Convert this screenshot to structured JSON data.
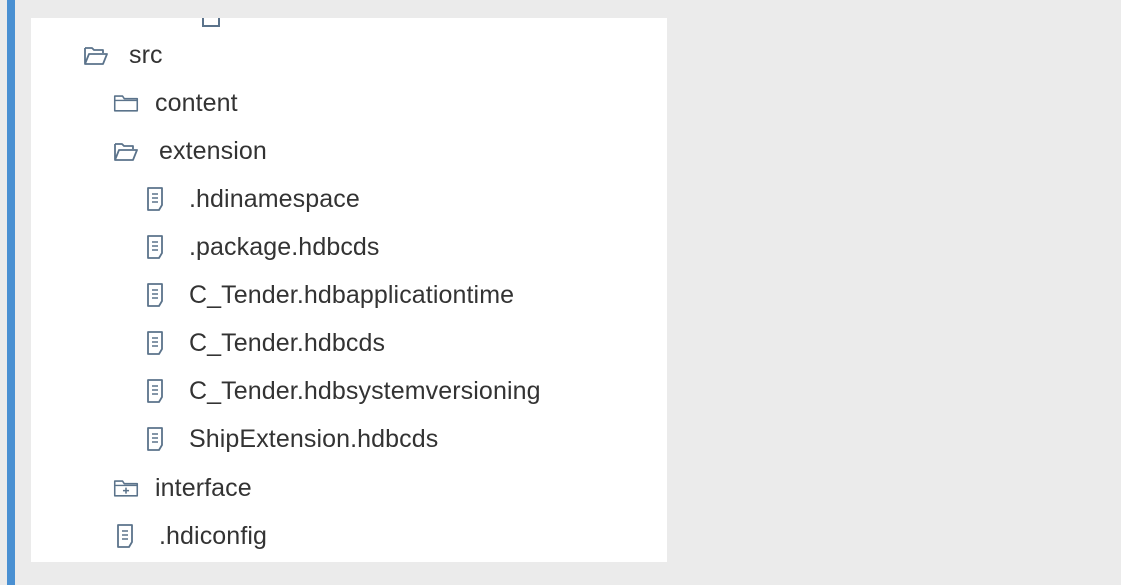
{
  "colors": {
    "accent": "#4a90d2",
    "page_bg": "#ebebeb",
    "panel_bg": "#ffffff",
    "icon_stroke": "#5b738b",
    "text": "#333333"
  },
  "tree": {
    "items": [
      {
        "label": "src",
        "icon": "folder-open-icon"
      },
      {
        "label": "content",
        "icon": "folder-icon"
      },
      {
        "label": "extension",
        "icon": "folder-open-icon"
      },
      {
        "label": ".hdinamespace",
        "icon": "document-icon"
      },
      {
        "label": ".package.hdbcds",
        "icon": "document-icon"
      },
      {
        "label": "C_Tender.hdbapplicationtime",
        "icon": "document-icon"
      },
      {
        "label": "C_Tender.hdbcds",
        "icon": "document-icon"
      },
      {
        "label": "C_Tender.hdbsystemversioning",
        "icon": "document-icon"
      },
      {
        "label": "ShipExtension.hdbcds",
        "icon": "document-icon"
      },
      {
        "label": "interface",
        "icon": "folder-add-icon"
      },
      {
        "label": ".hdiconfig",
        "icon": "document-icon"
      }
    ]
  }
}
